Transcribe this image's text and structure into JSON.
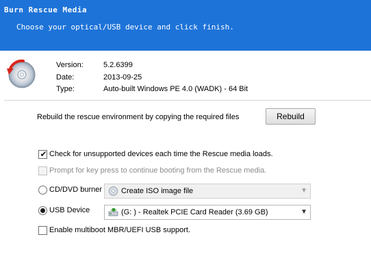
{
  "header": {
    "title": "Burn Rescue Media",
    "subtitle": "Choose your optical/USB device and click finish.",
    "background_color": "#1e73d8"
  },
  "info": {
    "version_label": "Version:",
    "version_value": "5.2.6399",
    "date_label": "Date:",
    "date_value": "2013-09-25",
    "type_label": "Type:",
    "type_value": "Auto-built Windows PE 4.0 (WADK) - 64 Bit"
  },
  "rebuild": {
    "text": "Rebuild the rescue environment by copying the required files",
    "button_label": "Rebuild"
  },
  "options": {
    "check_unsupported": {
      "label": "Check for unsupported devices each time the Rescue media loads.",
      "checked": true,
      "enabled": true
    },
    "prompt_key": {
      "label": "Prompt for key press to continue booting from the Rescue media.",
      "checked": false,
      "enabled": false
    },
    "enable_multiboot": {
      "label": "Enable multiboot MBR/UEFI USB support.",
      "checked": false,
      "enabled": true
    }
  },
  "devices": {
    "cd_dvd": {
      "label": "CD/DVD burner",
      "selected": false,
      "combo_value": "Create ISO image file",
      "combo_icon": "disc-icon",
      "enabled": false
    },
    "usb": {
      "label": "USB Device",
      "selected": true,
      "combo_value": "(G: ) - Realtek PCIE Card Reader (3.69 GB)",
      "combo_icon": "usb-drive-icon",
      "enabled": true
    }
  }
}
